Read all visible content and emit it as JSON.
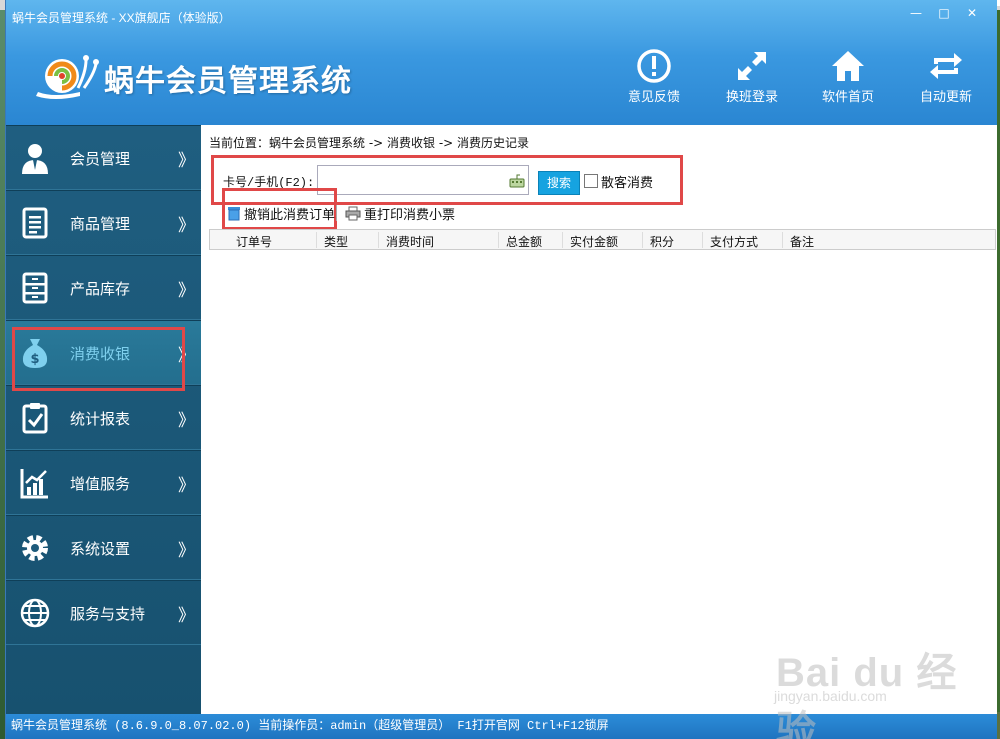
{
  "window": {
    "title": "蜗牛会员管理系统 - XX旗舰店（体验版）",
    "brand": "蜗牛会员管理系统",
    "controls": {
      "minimize": "—",
      "maximize": "□",
      "close": "✕"
    }
  },
  "toolbar": {
    "items": [
      {
        "label": "意见反馈",
        "icon": "alert-circle-icon"
      },
      {
        "label": "换班登录",
        "icon": "expand-arrows-icon"
      },
      {
        "label": "软件首页",
        "icon": "home-icon"
      },
      {
        "label": "自动更新",
        "icon": "refresh-icon"
      }
    ]
  },
  "sidebar": {
    "items": [
      {
        "label": "会员管理",
        "icon": "user-icon",
        "arrow": "》"
      },
      {
        "label": "商品管理",
        "icon": "document-icon",
        "arrow": "》"
      },
      {
        "label": "产品库存",
        "icon": "cabinet-icon",
        "arrow": "》"
      },
      {
        "label": "消费收银",
        "icon": "money-bag-icon",
        "arrow": "》",
        "active": true
      },
      {
        "label": "统计报表",
        "icon": "clipboard-check-icon",
        "arrow": "》"
      },
      {
        "label": "增值服务",
        "icon": "bar-chart-icon",
        "arrow": "》"
      },
      {
        "label": "系统设置",
        "icon": "gear-icon",
        "arrow": "》"
      },
      {
        "label": "服务与支持",
        "icon": "globe-icon",
        "arrow": "》"
      }
    ]
  },
  "main": {
    "breadcrumb": "当前位置：蜗牛会员管理系统 -> 消费收银 -> 消费历史记录",
    "search": {
      "label": "卡号/手机(F2):",
      "value": "",
      "button": "搜索",
      "checkbox_label": "散客消费",
      "checkbox_checked": false
    },
    "actions": {
      "cancel_order": "撤销此消费订单",
      "reprint_receipt": "重打印消费小票"
    },
    "table": {
      "columns": [
        "订单号",
        "类型",
        "消费时间",
        "总金额",
        "实付金额",
        "积分",
        "支付方式",
        "备注"
      ],
      "rows": []
    }
  },
  "statusbar": {
    "text": "蜗牛会员管理系统 (8.6.9.0_8.07.02.0)  当前操作员：admin（超级管理员）  F1打开官网 Ctrl+F12锁屏"
  },
  "watermark": {
    "brand": "Bai du 经验",
    "url": "jingyan.baidu.com"
  },
  "colors": {
    "titlebar": "#3a98e0",
    "sidebar": "#1f5e80",
    "active_label": "#7fd0ee",
    "highlight_box": "#e04848",
    "search_button": "#16a3e0",
    "statusbar": "#2c8cd8"
  }
}
